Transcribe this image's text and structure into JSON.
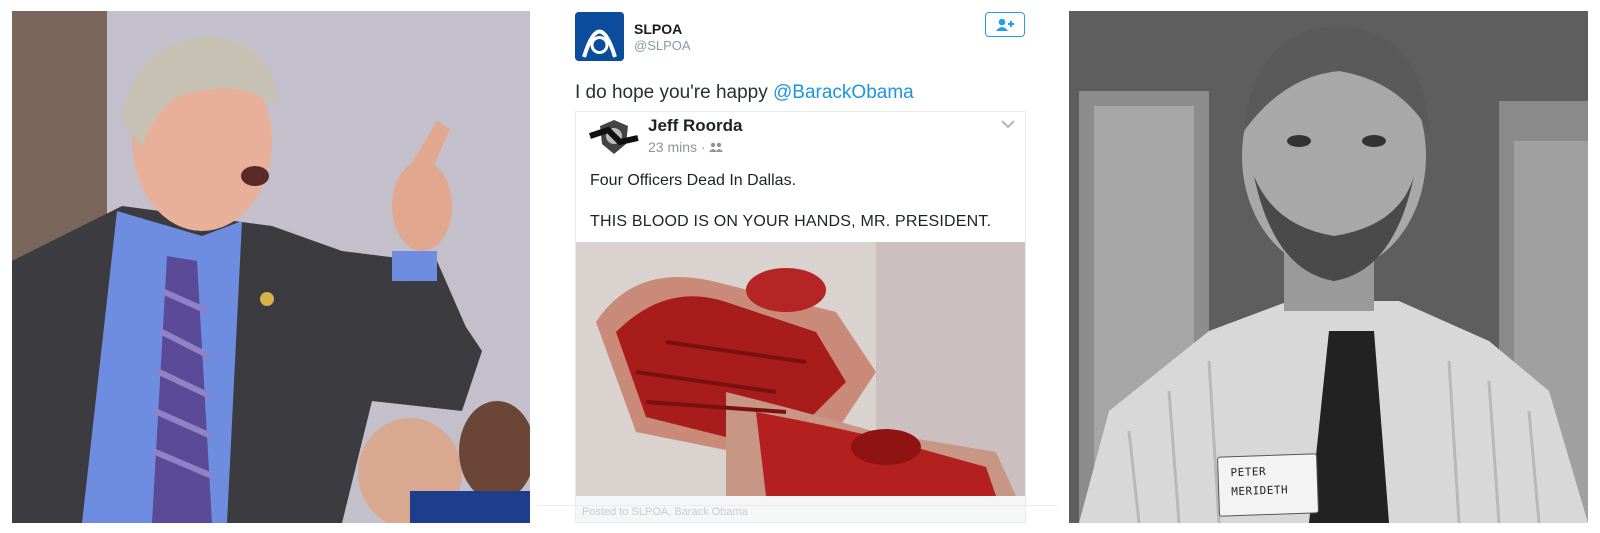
{
  "tweet": {
    "display_name": "SLPOA",
    "handle": "@SLPOA",
    "text_prefix": "I do hope you're happy ",
    "mention": "@BarackObama",
    "follow_icon": "add-user-icon",
    "accent_color": "#1da1f2",
    "mention_color": "#1b95e0"
  },
  "embedded_post": {
    "author": "Jeff Roorda",
    "time": "23 mins · ",
    "audience_icon": "friends-icon",
    "menu_icon": "chevron-down-icon",
    "line1": "Four Officers Dead In Dallas.",
    "line2": "THIS BLOOD IS ON YOUR HANDS, MR. PRESIDENT.",
    "footer_text": "Posted to SLPOA, Barack Obama"
  },
  "right_photo": {
    "nametag_line1": "PETER",
    "nametag_line2": "MERIDETH"
  }
}
